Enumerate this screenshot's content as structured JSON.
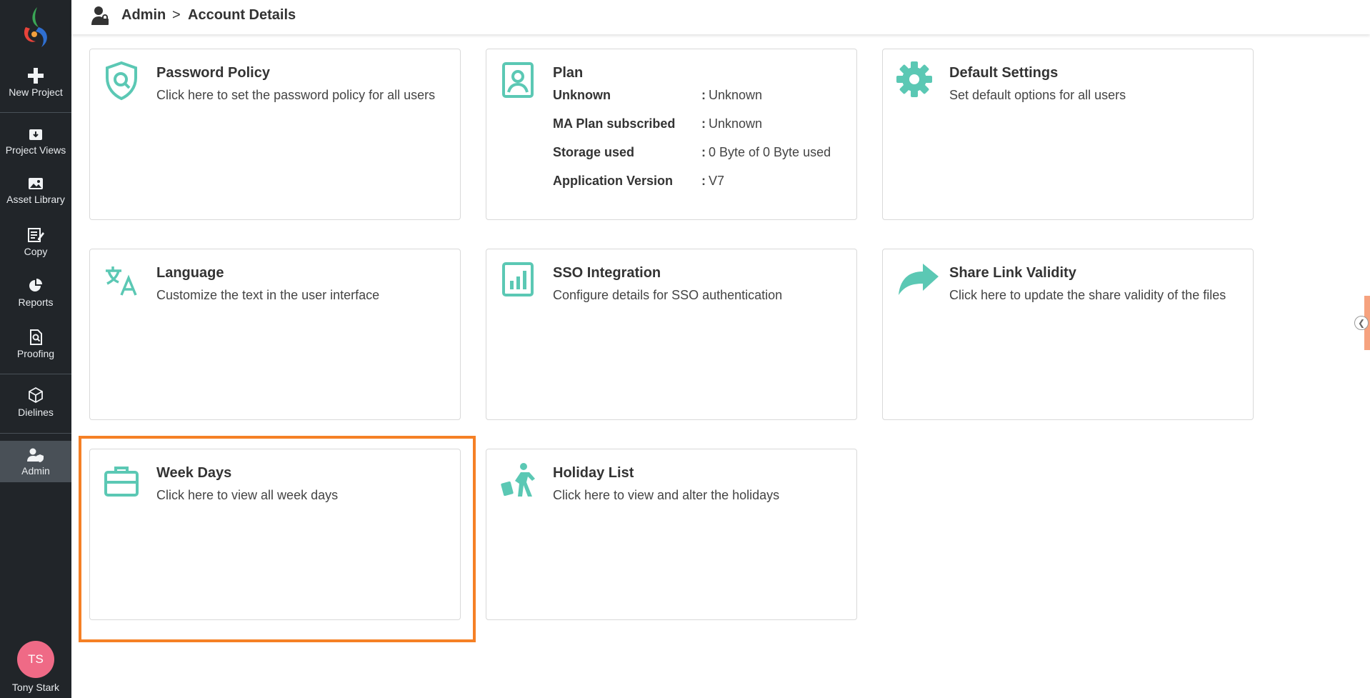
{
  "sidebar": {
    "items": [
      {
        "label": "New Project",
        "icon": "plus-icon"
      },
      {
        "label": "Project Views",
        "icon": "download-box-icon"
      },
      {
        "label": "Asset Library",
        "icon": "image-icon"
      },
      {
        "label": "Copy",
        "icon": "edit-document-icon"
      },
      {
        "label": "Reports",
        "icon": "pie-chart-icon"
      },
      {
        "label": "Proofing",
        "icon": "search-document-icon"
      },
      {
        "label": "Dielines",
        "icon": "cube-icon"
      },
      {
        "label": "Admin",
        "icon": "user-shield-icon"
      }
    ],
    "active_item": "Admin",
    "user": {
      "initials": "TS",
      "name": "Tony Stark"
    }
  },
  "header": {
    "breadcrumb_root": "Admin",
    "breadcrumb_separator": ">",
    "breadcrumb_current": "Account Details"
  },
  "cards": {
    "password_policy": {
      "title": "Password Policy",
      "desc": "Click here to set the password policy for all users"
    },
    "plan": {
      "title": "Plan",
      "rows": [
        {
          "key": "Unknown",
          "value": "Unknown"
        },
        {
          "key": "MA Plan subscribed",
          "value": "Unknown"
        },
        {
          "key": "Storage used",
          "value": "0 Byte of 0 Byte used"
        },
        {
          "key": "Application Version",
          "value": "V7"
        }
      ],
      "separator": ":"
    },
    "default_settings": {
      "title": "Default Settings",
      "desc": "Set default options for all users"
    },
    "language": {
      "title": "Language",
      "desc": "Customize the text in the user interface"
    },
    "sso": {
      "title": "SSO Integration",
      "desc": "Configure details for SSO authentication"
    },
    "share_link": {
      "title": "Share Link Validity",
      "desc": "Click here to update the share validity of the files"
    },
    "week_days": {
      "title": "Week Days",
      "desc": "Click here to view all week days"
    },
    "holiday_list": {
      "title": "Holiday List",
      "desc": "Click here to view and alter the holidays"
    }
  },
  "colors": {
    "accent": "#5bc8b4",
    "sidebar_bg": "#212529",
    "highlight": "#f58025",
    "avatar": "#ef6a86"
  }
}
